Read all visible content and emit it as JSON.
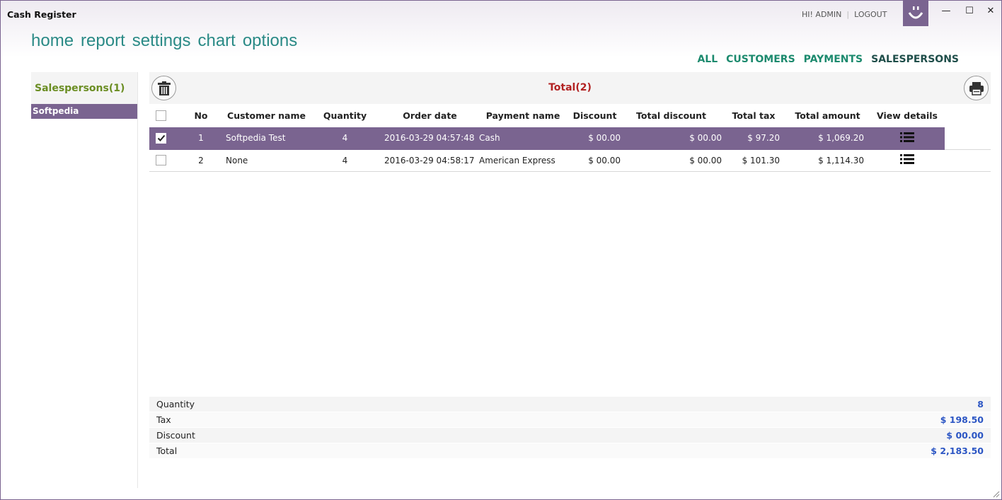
{
  "app": {
    "title": "Cash Register"
  },
  "user": {
    "greeting": "HI! ADMIN",
    "separator": "|",
    "logout": "LOGOUT"
  },
  "window_controls": {
    "minimize": "—",
    "maximize": "☐",
    "close": "✕"
  },
  "nav": [
    "home",
    "report",
    "settings",
    "chart",
    "options"
  ],
  "filters": [
    {
      "label": "ALL",
      "active": false
    },
    {
      "label": "CUSTOMERS",
      "active": false
    },
    {
      "label": "PAYMENTS",
      "active": false
    },
    {
      "label": "SALESPERSONS",
      "active": true
    }
  ],
  "sidebar": {
    "heading": "Salespersons(1)",
    "items": [
      "Softpedia"
    ]
  },
  "toolbar": {
    "total_label": "Total(2)",
    "delete_icon": "trash-icon",
    "print_icon": "printer-icon"
  },
  "table": {
    "columns": [
      "No",
      "Customer name",
      "Quantity",
      "Order date",
      "Payment name",
      "Discount",
      "Total discount",
      "Total tax",
      "Total amount",
      "View details"
    ],
    "rows": [
      {
        "checked": true,
        "no": "1",
        "customer": "Softpedia Test",
        "quantity": "4",
        "date": "2016-03-29 04:57:48",
        "payment": "Cash",
        "discount": "$ 00.00",
        "total_discount": "$ 00.00",
        "total_tax": "$ 97.20",
        "total_amount": "$ 1,069.20"
      },
      {
        "checked": false,
        "no": "2",
        "customer": "None",
        "quantity": "4",
        "date": "2016-03-29 04:58:17",
        "payment": "American Express",
        "discount": "$ 00.00",
        "total_discount": "$ 00.00",
        "total_tax": "$ 101.30",
        "total_amount": "$ 1,114.30"
      }
    ]
  },
  "summary": [
    {
      "label": "Quantity",
      "value": "8"
    },
    {
      "label": "Tax",
      "value": "$ 198.50"
    },
    {
      "label": "Discount",
      "value": "$ 00.00"
    },
    {
      "label": "Total",
      "value": "$ 2,183.50"
    }
  ],
  "colors": {
    "accent": "#7a6490",
    "nav": "#2a8a86",
    "total": "#b22222",
    "summary_value": "#2c56c4"
  }
}
